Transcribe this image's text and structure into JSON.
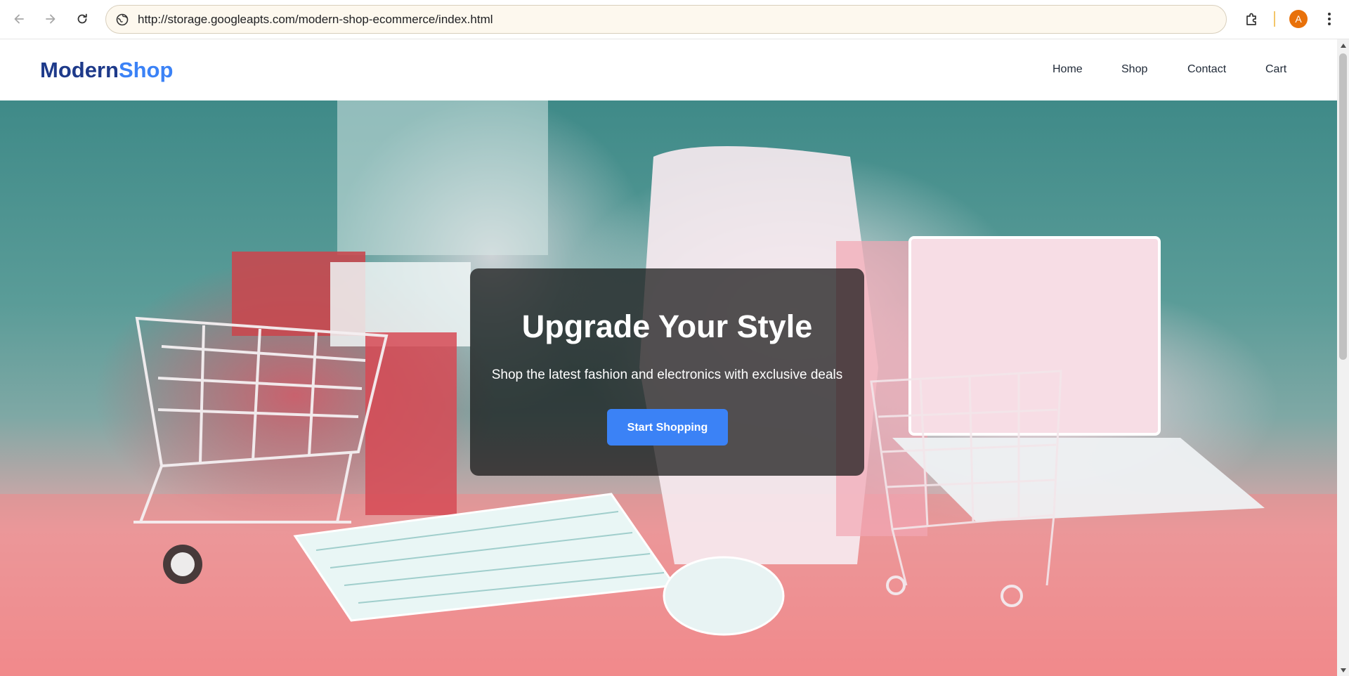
{
  "browser": {
    "url": "http://storage.googleapts.com/modern-shop-ecommerce/index.html",
    "profile_initial": "A",
    "icons": {
      "back": "arrow-left-icon",
      "forward": "arrow-right-icon",
      "reload": "reload-icon",
      "site_info": "site-info-icon",
      "extensions": "puzzle-icon",
      "menu": "kebab-menu-icon"
    },
    "colors": {
      "omnibox_bg": "#fdf8ee",
      "profile_avatar": "#e8710a"
    }
  },
  "site": {
    "logo": {
      "part1": "Modern",
      "part2": "Shop"
    },
    "nav": [
      "Home",
      "Shop",
      "Contact",
      "Cart"
    ],
    "colors": {
      "logo_dark": "#1e3a8a",
      "accent": "#3b82f6"
    }
  },
  "hero": {
    "title": "Upgrade Your Style",
    "subtitle": "Shop the latest fashion and electronics with exclusive deals",
    "cta_label": "Start Shopping",
    "colors": {
      "card_overlay": "#141414",
      "button": "#3b82f6"
    }
  }
}
